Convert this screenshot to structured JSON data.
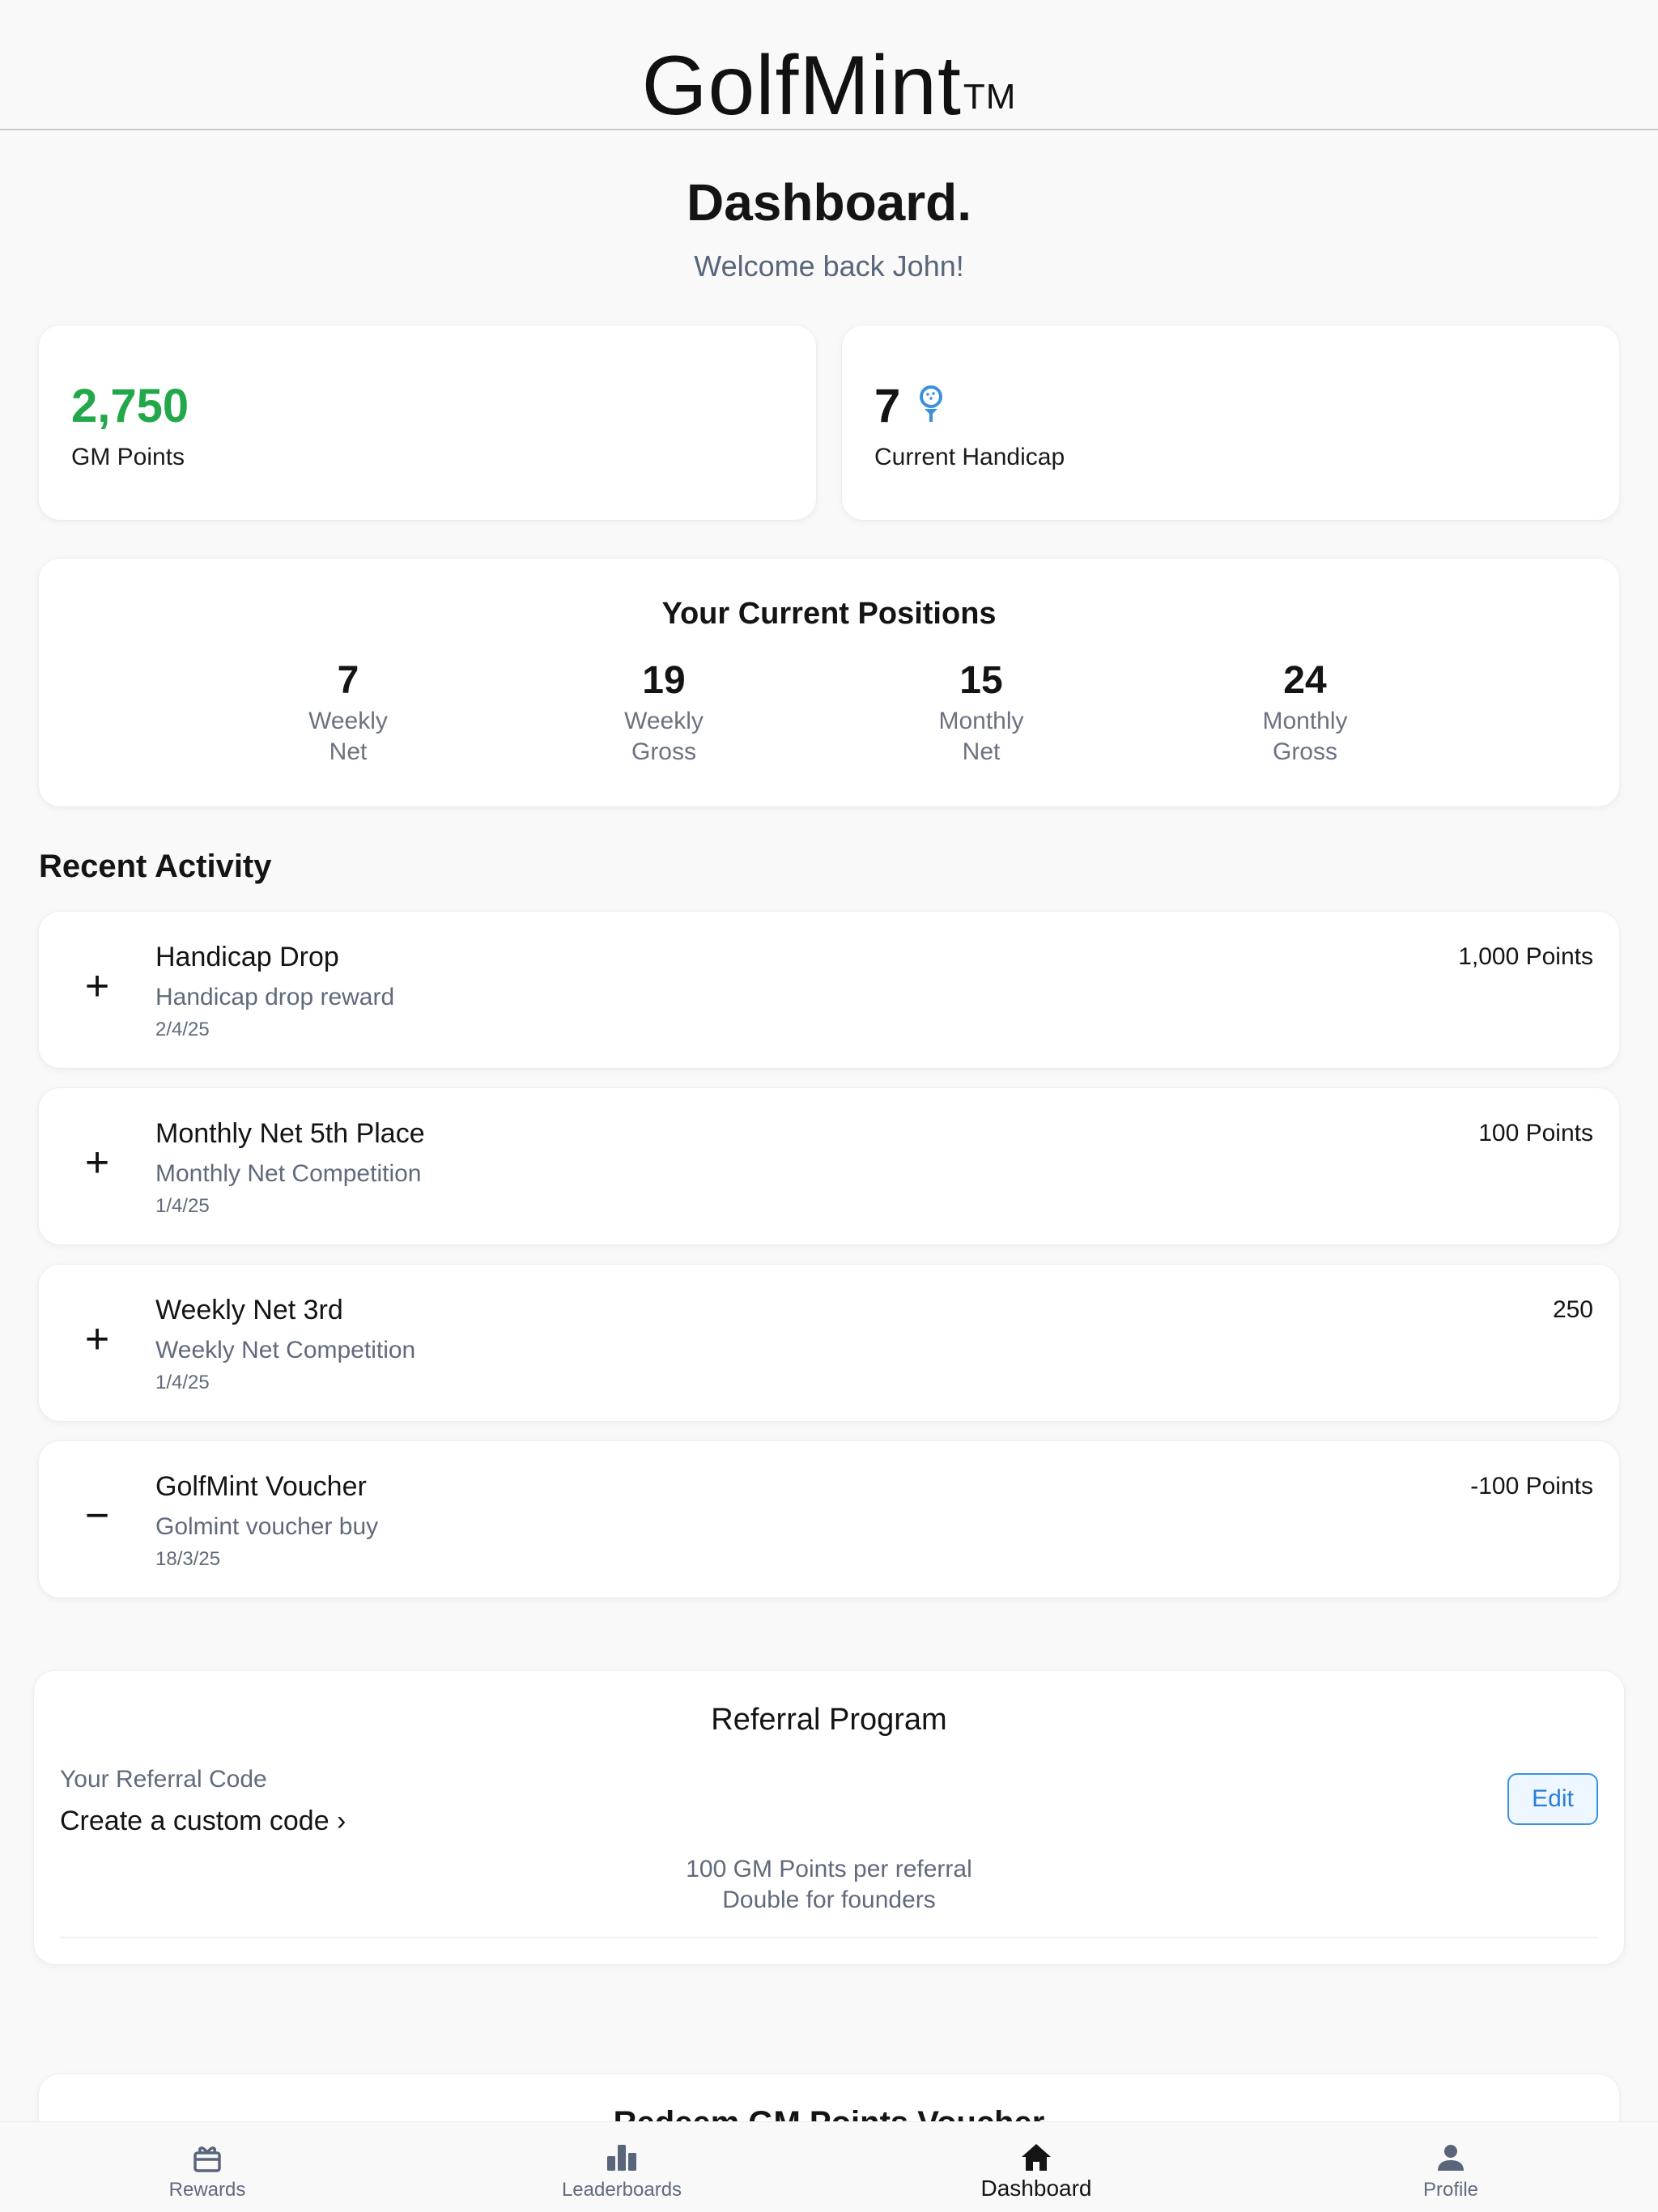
{
  "header": {
    "brand": "GolfMint",
    "trademark": "TM"
  },
  "page": {
    "title": "Dashboard.",
    "welcome": "Welcome back John!"
  },
  "stats": {
    "points": {
      "value": "2,750",
      "label": "GM Points",
      "color": "#22a84a"
    },
    "handicap": {
      "value": "7",
      "label": "Current Handicap",
      "icon": "golf-ball-tee-icon",
      "icon_color": "#3b91e0"
    }
  },
  "positions": {
    "title": "Your Current Positions",
    "items": [
      {
        "value": "7",
        "line1": "Weekly",
        "line2": "Net"
      },
      {
        "value": "19",
        "line1": "Weekly",
        "line2": "Gross"
      },
      {
        "value": "15",
        "line1": "Monthly",
        "line2": "Net"
      },
      {
        "value": "24",
        "line1": "Monthly",
        "line2": "Gross"
      }
    ]
  },
  "activity": {
    "title": "Recent Activity",
    "items": [
      {
        "sign": "+",
        "title": "Handicap Drop",
        "subtitle": "Handicap drop reward",
        "date": "2/4/25",
        "points": "1,000 Points"
      },
      {
        "sign": "+",
        "title": "Monthly Net 5th Place",
        "subtitle": "Monthly Net Competition",
        "date": "1/4/25",
        "points": "100 Points"
      },
      {
        "sign": "+",
        "title": "Weekly Net 3rd",
        "subtitle": "Weekly Net Competition",
        "date": "1/4/25",
        "points": "250"
      },
      {
        "sign": "−",
        "title": "GolfMint Voucher",
        "subtitle": "Golmint voucher buy",
        "date": "18/3/25",
        "points": "-100 Points"
      }
    ]
  },
  "referral": {
    "title": "Referral Program",
    "code_label": "Your Referral Code",
    "create_label": "Create a custom code ›",
    "edit_label": "Edit",
    "info_line1": "100 GM Points per referral",
    "info_line2": "Double for founders"
  },
  "redeem": {
    "title": "Redeem GM Points Voucher"
  },
  "nav": {
    "items": [
      {
        "label": "Rewards",
        "icon": "gift-icon"
      },
      {
        "label": "Leaderboards",
        "icon": "bar-chart-icon"
      },
      {
        "label": "Dashboard",
        "icon": "home-icon",
        "active": true
      },
      {
        "label": "Profile",
        "icon": "person-icon"
      }
    ]
  }
}
